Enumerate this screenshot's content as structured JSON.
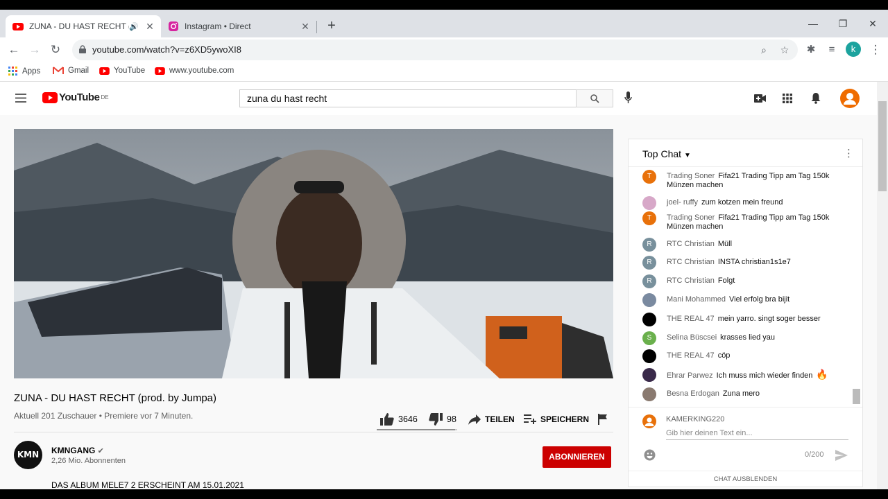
{
  "browser": {
    "tabs": [
      {
        "title": "ZUNA - DU HAST RECHT (prod. by Jumpa) - YouTube",
        "icon": "youtube-icon",
        "audio": true,
        "active": true
      },
      {
        "title": "Instagram • Direct",
        "icon": "instagram-icon",
        "active": false
      }
    ],
    "url": "youtube.com/watch?v=z6XD5ywoXI8",
    "profile_initial": "k",
    "bookmarks": [
      {
        "label": "Apps",
        "icon": "apps-grid-icon"
      },
      {
        "label": "Gmail",
        "icon": "gmail-icon"
      },
      {
        "label": "YouTube",
        "icon": "youtube-icon"
      },
      {
        "label": "www.youtube.com",
        "icon": "youtube-icon"
      }
    ]
  },
  "youtube": {
    "logo_text": "YouTube",
    "region": "DE",
    "search_query": "zuna du hast recht",
    "video": {
      "title": "ZUNA - DU HAST RECHT (prod. by Jumpa)",
      "meta": "Aktuell 201 Zuschauer • Premiere vor 7 Minuten.",
      "likes": "3646",
      "dislikes": "98",
      "like_ratio": 0.974,
      "share_label": "TEILEN",
      "save_label": "SPEICHERN"
    },
    "channel": {
      "avatar_text": "KMN",
      "name": "KMNGANG",
      "subscribers": "2,26 Mio. Abonnenten",
      "subscribe_label": "ABONNIEREN",
      "description": "DAS ALBUM MELE7 2 ERSCHEINT AM 15.01.2021"
    },
    "chat": {
      "mode": "Top Chat",
      "messages": [
        {
          "author": "Trading Soner",
          "text": "Fifa21 Trading Tipp am Tag 150k Münzen machen",
          "initial": "T",
          "color": "#e8710a"
        },
        {
          "author": "joel- ruffy",
          "text": "zum kotzen mein freund",
          "initial": "",
          "color": "#d7a8c8"
        },
        {
          "author": "Trading Soner",
          "text": "Fifa21 Trading Tipp am Tag 150k Münzen machen",
          "initial": "T",
          "color": "#e8710a"
        },
        {
          "author": "RTC Christian",
          "text": "Müll",
          "initial": "R",
          "color": "#78909c"
        },
        {
          "author": "RTC Christian",
          "text": "INSTA christian1s1e7",
          "initial": "R",
          "color": "#78909c"
        },
        {
          "author": "RTC Christian",
          "text": "Folgt",
          "initial": "R",
          "color": "#78909c"
        },
        {
          "author": "Mani Mohammed",
          "text": "Viel erfolg bra bijit",
          "initial": "",
          "color": "#7a8aa0"
        },
        {
          "author": "THE REAL 47",
          "text": "mein yarro. singt soger besser",
          "initial": "",
          "color": "#000000"
        },
        {
          "author": "Selina Büscsei",
          "text": "krasses lied yau",
          "initial": "S",
          "color": "#6ab04c"
        },
        {
          "author": "THE REAL 47",
          "text": "cöp",
          "initial": "",
          "color": "#000000"
        },
        {
          "author": "Ehrar Parwez",
          "text": "Ich muss mich wieder finden",
          "initial": "",
          "color": "#3a2a4a",
          "emoji": "🔥"
        },
        {
          "author": "Besna Erdogan",
          "text": "Zuna mero",
          "initial": "",
          "color": "#8a7a70"
        }
      ],
      "current_user": "KAMERKING220",
      "input_placeholder": "Gib hier deinen Text ein...",
      "char_count": "0/200",
      "hide_label": "CHAT AUSBLENDEN"
    }
  }
}
